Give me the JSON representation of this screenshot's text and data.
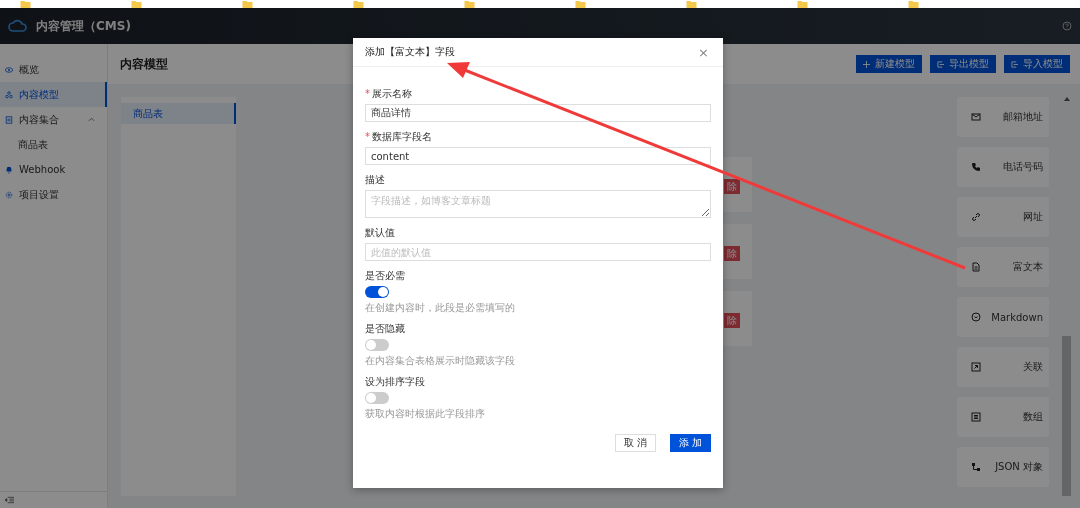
{
  "app": {
    "title": "内容管理（CMS)"
  },
  "sidebar": {
    "items": [
      {
        "label": "概览",
        "selected": false
      },
      {
        "label": "内容模型",
        "selected": true
      },
      {
        "label": "内容集合",
        "selected": false,
        "expanded": true,
        "children": [
          {
            "label": "商品表",
            "selected": false
          }
        ]
      },
      {
        "label": "Webhook",
        "selected": false
      },
      {
        "label": "项目设置",
        "selected": false
      }
    ]
  },
  "page": {
    "title": "内容模型",
    "buttons": [
      {
        "label": "新建模型"
      },
      {
        "label": "导出模型"
      },
      {
        "label": "导入模型"
      }
    ]
  },
  "models": [
    {
      "label": "商品表",
      "selected": true
    }
  ],
  "field_cards": [
    {
      "delete_label": "除"
    },
    {
      "delete_label": "除"
    },
    {
      "delete_label": "除"
    }
  ],
  "field_types": [
    {
      "label": "邮箱地址"
    },
    {
      "label": "电话号码"
    },
    {
      "label": "网址"
    },
    {
      "label": "富文本"
    },
    {
      "label": "Markdown"
    },
    {
      "label": "关联"
    },
    {
      "label": "数组"
    },
    {
      "label": "JSON 对象"
    }
  ],
  "dialog": {
    "title": "添加【富文本】字段",
    "close": "×",
    "required_mark": "*",
    "fields": [
      {
        "kind": "input",
        "label": "展示名称",
        "required": true,
        "value": "商品详情"
      },
      {
        "kind": "input",
        "label": "数据库字段名",
        "required": true,
        "value": "content"
      },
      {
        "kind": "textarea",
        "label": "描述",
        "required": false,
        "placeholder": "字段描述，如博客文章标题"
      },
      {
        "kind": "input",
        "label": "默认值",
        "required": false,
        "placeholder": "此值的默认值"
      },
      {
        "kind": "switch",
        "label": "是否必需",
        "on": true,
        "hint": "在创建内容时，此段是必需填写的"
      },
      {
        "kind": "switch",
        "label": "是否隐藏",
        "on": false,
        "hint": "在内容集合表格展示时隐藏该字段"
      },
      {
        "kind": "switch",
        "label": "设为排序字段",
        "on": false,
        "hint": "获取内容时根据此字段排序"
      }
    ],
    "buttons": [
      {
        "label": "取 消",
        "primary": false
      },
      {
        "label": "添 加",
        "primary": true
      }
    ]
  }
}
